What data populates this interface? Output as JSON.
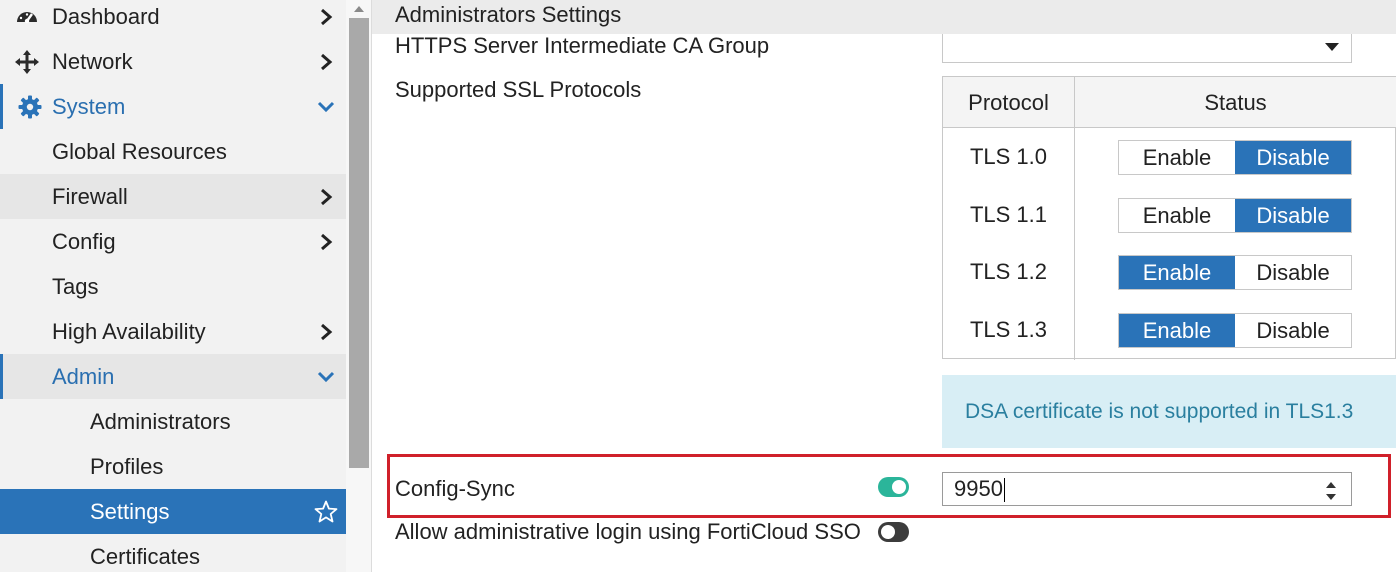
{
  "sidebar": {
    "items": [
      {
        "label": "Dashboard",
        "icon": "dashboard-icon",
        "chevron": "right"
      },
      {
        "label": "Network",
        "icon": "move-arrows-icon",
        "chevron": "right"
      },
      {
        "label": "System",
        "icon": "gear-icon",
        "chevron": "down"
      },
      {
        "label": "Global Resources"
      },
      {
        "label": "Firewall",
        "chevron": "right"
      },
      {
        "label": "Config",
        "chevron": "right"
      },
      {
        "label": "Tags"
      },
      {
        "label": "High Availability",
        "chevron": "right"
      },
      {
        "label": "Admin",
        "chevron": "down"
      },
      {
        "label": "Administrators"
      },
      {
        "label": "Profiles"
      },
      {
        "label": "Settings",
        "icon": "star-icon"
      },
      {
        "label": "Certificates"
      }
    ]
  },
  "main": {
    "section_title": "Administrators Settings",
    "ca_group_label": "HTTPS Server Intermediate CA Group",
    "ca_group_value": "",
    "ssl_label": "Supported SSL Protocols",
    "ssl_table": {
      "headers": [
        "Protocol",
        "Status"
      ],
      "enable_label": "Enable",
      "disable_label": "Disable",
      "rows": [
        {
          "protocol": "TLS 1.0",
          "enable": "Enable",
          "disable": "Disable",
          "selected": "Disable"
        },
        {
          "protocol": "TLS 1.1",
          "enable": "Enable",
          "disable": "Disable",
          "selected": "Disable"
        },
        {
          "protocol": "TLS 1.2",
          "enable": "Enable",
          "disable": "Disable",
          "selected": "Enable"
        },
        {
          "protocol": "TLS 1.3",
          "enable": "Enable",
          "disable": "Disable",
          "selected": "Enable"
        }
      ]
    },
    "dsa_note": "DSA certificate is not supported in TLS1.3",
    "config_sync": {
      "label": "Config-Sync",
      "enabled": true,
      "port": "9950"
    },
    "forticloud_sso": {
      "label": "Allow administrative login using FortiCloud SSO",
      "enabled": false
    }
  },
  "colors": {
    "accent": "#2a73b8",
    "highlight_border": "#d0202a",
    "toggle_on": "#2bb59a",
    "note_bg": "#d8eef5",
    "note_text": "#2a7f9f"
  }
}
